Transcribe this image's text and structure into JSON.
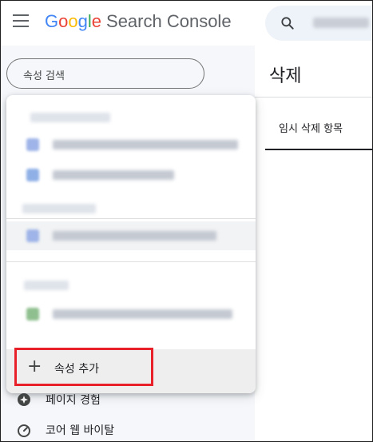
{
  "topbar": {
    "brand_letters": [
      "G",
      "o",
      "o",
      "g",
      "l",
      "e"
    ],
    "brand_colors": [
      "#4285F4",
      "#EA4335",
      "#FBBC05",
      "#4285F4",
      "#34A853",
      "#EA4335"
    ],
    "product": "Search Console"
  },
  "sidebar": {
    "search_placeholder": "속성 검색",
    "nav": [
      {
        "label": "페이지 경험",
        "icon": "star-badge-icon"
      },
      {
        "label": "코어 웹 바이탈",
        "icon": "gauge-icon"
      }
    ]
  },
  "dropdown": {
    "add_property_label": "속성 추가",
    "add_icon": "+",
    "selected_row_index": 2
  },
  "main": {
    "title": "삭제",
    "tabs": [
      {
        "label": "임시 삭제 항목"
      }
    ]
  },
  "colors": {
    "accent_highlight": "#e8202a",
    "sidebar_bg": "#f5f7fb"
  }
}
